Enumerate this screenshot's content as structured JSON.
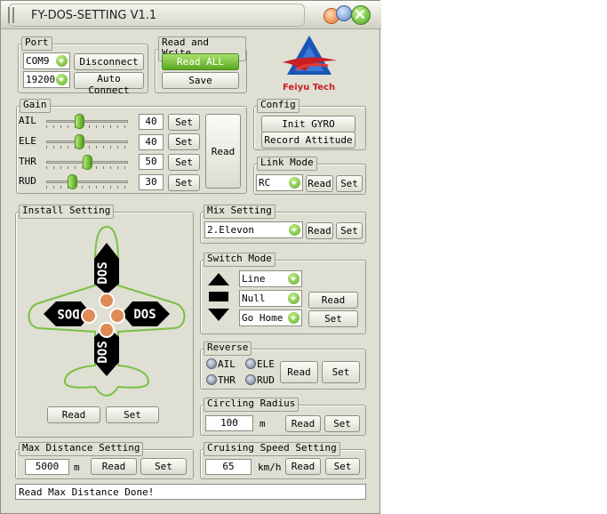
{
  "window": {
    "title": "FY-DOS-SETTING V1.1"
  },
  "colors": {
    "accent_green": "#5aa822",
    "panel": "#dfdfd4",
    "logo_blue": "#1a56b8",
    "logo_red": "#c81e24"
  },
  "port": {
    "legend": "Port",
    "com": "COM9",
    "baud": "19200",
    "disconnect": "Disconnect",
    "auto_connect": "Auto Connect"
  },
  "readwrite": {
    "legend": "Read and Write",
    "read_all": "Read ALL",
    "save": "Save"
  },
  "logo": {
    "text": "Feiyu Tech"
  },
  "gain": {
    "legend": "Gain",
    "rows": [
      {
        "label": "AIL",
        "value": "40",
        "level": 0.4
      },
      {
        "label": "ELE",
        "value": "40",
        "level": 0.4
      },
      {
        "label": "THR",
        "value": "50",
        "level": 0.5
      },
      {
        "label": "RUD",
        "value": "30",
        "level": 0.3
      }
    ],
    "set": "Set",
    "read": "Read"
  },
  "config": {
    "legend": "Config",
    "init_gyro": "Init GYRO",
    "record_attitude": "Record Attitude"
  },
  "link_mode": {
    "legend": "Link Mode",
    "value": "RC",
    "read": "Read",
    "set": "Set"
  },
  "install": {
    "legend": "Install Setting",
    "read": "Read",
    "set": "Set",
    "logo_text": "DOS"
  },
  "mix": {
    "legend": "Mix Setting",
    "value": "2.Elevon",
    "read": "Read",
    "set": "Set"
  },
  "switch_mode": {
    "legend": "Switch Mode",
    "up": "Line",
    "mid": "Null",
    "down": "Go Home",
    "read": "Read",
    "set": "Set"
  },
  "reverse": {
    "legend": "Reverse",
    "ail": "AIL",
    "ele": "ELE",
    "thr": "THR",
    "rud": "RUD",
    "read": "Read",
    "set": "Set"
  },
  "circling": {
    "legend": "Circling Radius",
    "value": "100",
    "unit": "m",
    "read": "Read",
    "set": "Set"
  },
  "maxdist": {
    "legend": "Max Distance Setting",
    "value": "5000",
    "unit": "m",
    "read": "Read",
    "set": "Set"
  },
  "cruise": {
    "legend": "Cruising Speed Setting",
    "value": "65",
    "unit": "km/h",
    "read": "Read",
    "set": "Set"
  },
  "status": {
    "text": "Read Max Distance Done!"
  }
}
